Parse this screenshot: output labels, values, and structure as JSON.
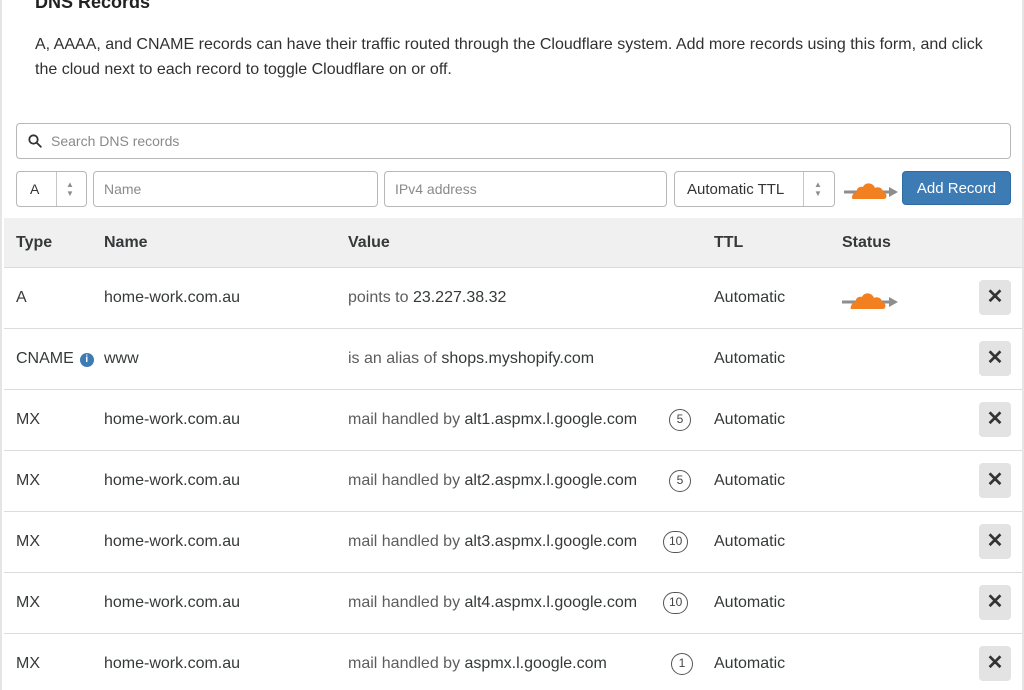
{
  "section": {
    "title": "DNS Records",
    "description": "A, AAAA, and CNAME records can have their traffic routed through the Cloudflare system. Add more records using this form, and click the cloud next to each record to toggle Cloudflare on or off."
  },
  "search": {
    "placeholder": "Search DNS records",
    "icon": "search-icon"
  },
  "form": {
    "type_value": "A",
    "name_placeholder": "Name",
    "value_placeholder": "IPv4 address",
    "ttl_value": "Automatic TTL",
    "proxy_icon": "cloud-proxy-icon",
    "add_label": "Add Record"
  },
  "table": {
    "headers": {
      "type": "Type",
      "name": "Name",
      "value": "Value",
      "ttl": "TTL",
      "status": "Status"
    },
    "rows": [
      {
        "type": "A",
        "name": "home-work.com.au",
        "value_prefix": "points to",
        "value_target": "23.227.38.32",
        "ttl": "Automatic",
        "proxied": true
      },
      {
        "type": "CNAME",
        "name": "www",
        "value_prefix": "is an alias of",
        "value_target": "shops.myshopify.com",
        "ttl": "Automatic",
        "info": "i"
      },
      {
        "type": "MX",
        "name": "home-work.com.au",
        "value_prefix": "mail handled by",
        "value_target": "alt1.aspmx.l.google.com",
        "priority": "5",
        "ttl": "Automatic"
      },
      {
        "type": "MX",
        "name": "home-work.com.au",
        "value_prefix": "mail handled by",
        "value_target": "alt2.aspmx.l.google.com",
        "priority": "5",
        "ttl": "Automatic"
      },
      {
        "type": "MX",
        "name": "home-work.com.au",
        "value_prefix": "mail handled by",
        "value_target": "alt3.aspmx.l.google.com",
        "priority": "10",
        "ttl": "Automatic"
      },
      {
        "type": "MX",
        "name": "home-work.com.au",
        "value_prefix": "mail handled by",
        "value_target": "alt4.aspmx.l.google.com",
        "priority": "10",
        "ttl": "Automatic"
      },
      {
        "type": "MX",
        "name": "home-work.com.au",
        "value_prefix": "mail handled by",
        "value_target": "aspmx.l.google.com",
        "priority": "1",
        "ttl": "Automatic"
      }
    ],
    "delete_glyph": "✕"
  },
  "colors": {
    "accent": "#3d7bb5",
    "cloud_orange": "#f38020",
    "arrow_gray": "#8e8e8e"
  }
}
